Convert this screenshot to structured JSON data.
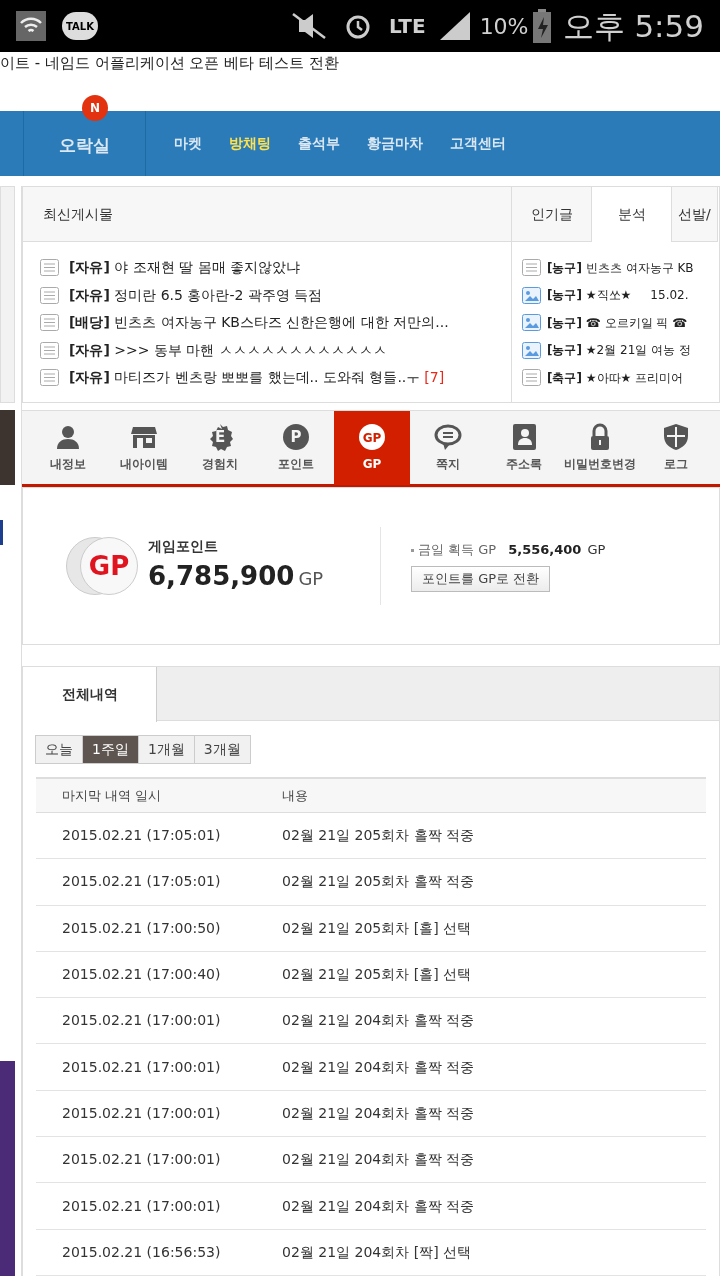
{
  "status_bar": {
    "talk": "TALK",
    "network": "LTE",
    "battery": "10%",
    "time": "오후 5:59"
  },
  "page_title": "이트 - 네임드 어플리케이션 오픈 베타 테스트 전환",
  "nav": {
    "home": "오락실",
    "badge": "N",
    "items": [
      {
        "label": "마켓",
        "selected": false
      },
      {
        "label": "방채팅",
        "selected": true
      },
      {
        "label": "출석부",
        "selected": false
      },
      {
        "label": "황금마차",
        "selected": false
      },
      {
        "label": "고객센터",
        "selected": false
      }
    ]
  },
  "board": {
    "title": "최신게시물",
    "tabs": [
      {
        "label": "인기글",
        "selected": false
      },
      {
        "label": "분석",
        "selected": true
      },
      {
        "label": "선발/",
        "selected": false
      }
    ],
    "posts": [
      {
        "kind": "text",
        "tag": "[자유]",
        "title": "야 조재현 딸 몸매 좋지않았냐"
      },
      {
        "kind": "text",
        "tag": "[자유]",
        "title": "정미란 6.5 홍아란-2 곽주영 득점"
      },
      {
        "kind": "text",
        "tag": "[배당]",
        "title": "빈츠츠 여자농구 KB스타즈 신한은행에 대한 저만의..."
      },
      {
        "kind": "text",
        "tag": "[자유]",
        "title": ">>> 동부 마핸 ㅅㅅㅅㅅㅅㅅㅅㅅㅅㅅㅅㅅ"
      },
      {
        "kind": "text",
        "tag": "[자유]",
        "title": "마티즈가 벤츠랑 뽀뽀를 했는데.. 도와줘 형들..ㅜ",
        "comments": "[7]"
      }
    ],
    "analysis": [
      {
        "kind": "text",
        "tag": "[농구]",
        "title": "빈츠츠 여자농구 KB"
      },
      {
        "kind": "image",
        "tag": "[농구]",
        "title": "★직쏘★     15.02."
      },
      {
        "kind": "image",
        "tag": "[농구]",
        "title": "☎ 오르키일 픽 ☎"
      },
      {
        "kind": "image",
        "tag": "[농구]",
        "title": "★2월 21일 여농 정"
      },
      {
        "kind": "text",
        "tag": "[축구]",
        "title": "★아따★ 프리미어"
      }
    ]
  },
  "menu": [
    {
      "kind": "person",
      "label": "내정보",
      "selected": false
    },
    {
      "kind": "shop",
      "label": "내아이템",
      "selected": false
    },
    {
      "kind": "exp",
      "label": "경험치",
      "selected": false,
      "glyph": "E"
    },
    {
      "kind": "point",
      "label": "포인트",
      "selected": false,
      "glyph": "P"
    },
    {
      "kind": "gp",
      "label": "GP",
      "selected": true,
      "glyph": "GP"
    },
    {
      "kind": "message",
      "label": "쪽지",
      "selected": false
    },
    {
      "kind": "contacts",
      "label": "주소록",
      "selected": false
    },
    {
      "kind": "lock",
      "label": "비밀번호변경",
      "selected": false
    },
    {
      "kind": "shield",
      "label": "로그",
      "selected": false
    }
  ],
  "gp_panel": {
    "coin": "GP",
    "label": "게임포인트",
    "amount": "6,785,900",
    "unit": "GP",
    "today_label": "금일 획득 GP",
    "today_amount": "5,556,400",
    "today_unit": "GP",
    "convert_button": "포인트를 GP로 전환"
  },
  "history": {
    "tab": "전체내역",
    "periods": [
      {
        "label": "오늘",
        "selected": false
      },
      {
        "label": "1주일",
        "selected": true
      },
      {
        "label": "1개월",
        "selected": false
      },
      {
        "label": "3개월",
        "selected": false
      }
    ],
    "columns": [
      "마지막 내역 일시",
      "내용"
    ],
    "rows": [
      [
        "2015.02.21 (17:05:01)",
        "02월 21일 205회차 홀짝 적중"
      ],
      [
        "2015.02.21 (17:05:01)",
        "02월 21일 205회차 홀짝 적중"
      ],
      [
        "2015.02.21 (17:00:50)",
        "02월 21일 205회차 [홀] 선택"
      ],
      [
        "2015.02.21 (17:00:40)",
        "02월 21일 205회차 [홀] 선택"
      ],
      [
        "2015.02.21 (17:00:01)",
        "02월 21일 204회차 홀짝 적중"
      ],
      [
        "2015.02.21 (17:00:01)",
        "02월 21일 204회차 홀짝 적중"
      ],
      [
        "2015.02.21 (17:00:01)",
        "02월 21일 204회차 홀짝 적중"
      ],
      [
        "2015.02.21 (17:00:01)",
        "02월 21일 204회차 홀짝 적중"
      ],
      [
        "2015.02.21 (17:00:01)",
        "02월 21일 204회차 홀짝 적중"
      ],
      [
        "2015.02.21 (16:56:53)",
        "02월 21일 204회차 [짝] 선택"
      ]
    ]
  }
}
